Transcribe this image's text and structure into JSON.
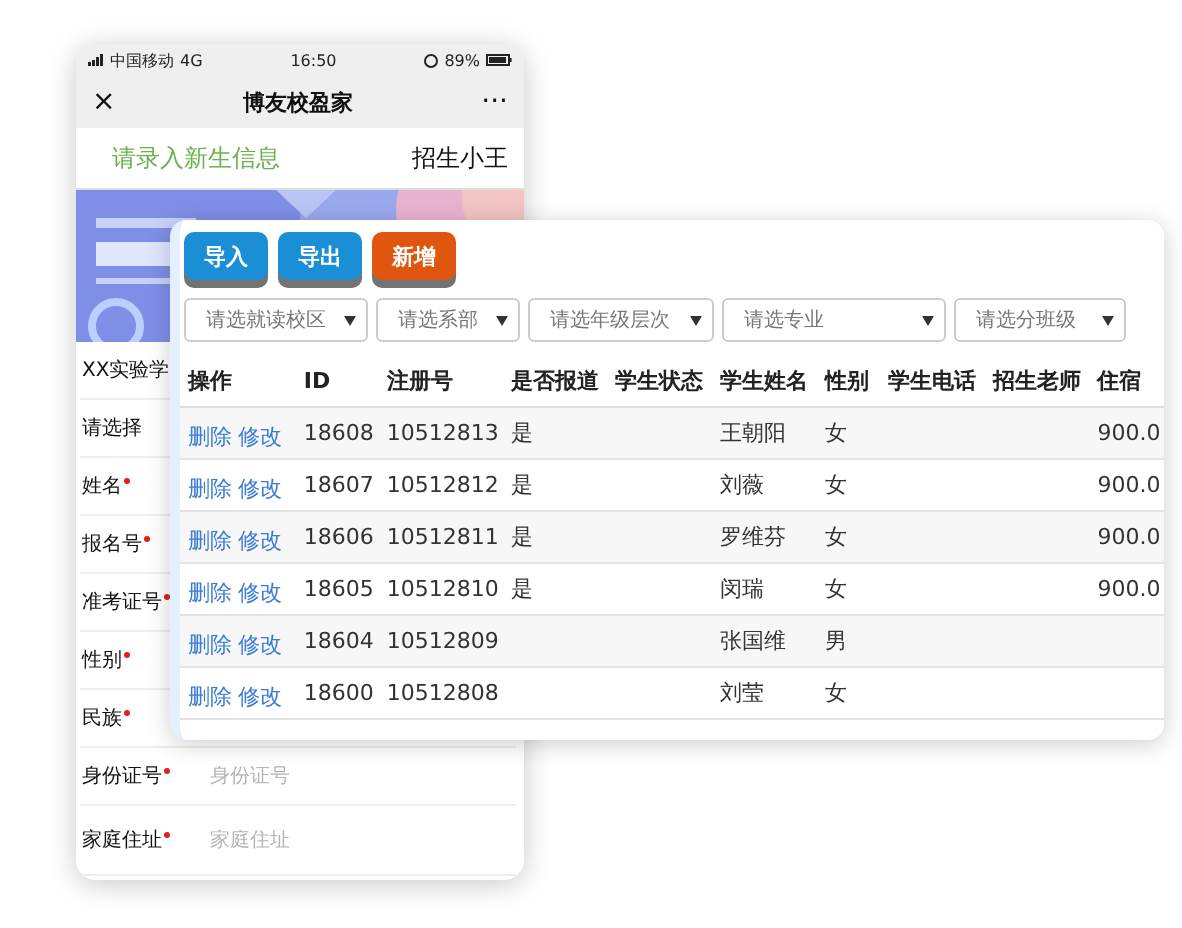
{
  "phone": {
    "status_bar": {
      "carrier": "中国移动",
      "network": "4G",
      "time": "16:50",
      "battery": "89%"
    },
    "nav": {
      "close": "×",
      "title": "博友校盈家",
      "more": "···"
    },
    "header": {
      "prompt": "请录入新生信息",
      "user": "招生小王"
    },
    "form": [
      {
        "label": "XX实验学",
        "required": false
      },
      {
        "label": "请选择",
        "required": false
      },
      {
        "label": "姓名",
        "required": true
      },
      {
        "label": "报名号",
        "required": true
      },
      {
        "label": "准考证号",
        "required": true
      },
      {
        "label": "性别",
        "required": true
      },
      {
        "label": "民族",
        "required": true
      },
      {
        "label": "身份证号",
        "required": true,
        "placeholder": "身份证号"
      },
      {
        "label": "家庭住址",
        "required": true,
        "placeholder": "家庭住址"
      }
    ]
  },
  "panel": {
    "buttons": [
      {
        "label": "导入",
        "color": "#1a8fd6"
      },
      {
        "label": "导出",
        "color": "#1a8fd6"
      },
      {
        "label": "新增",
        "color": "#e0560f"
      }
    ],
    "filters": [
      {
        "placeholder": "请选就读校区"
      },
      {
        "placeholder": "请选系部"
      },
      {
        "placeholder": "请选年级层次"
      },
      {
        "placeholder": "请选专业"
      },
      {
        "placeholder": "请选分班级"
      }
    ],
    "table": {
      "columns": [
        "操作",
        "ID",
        "注册号",
        "是否报道",
        "学生状态",
        "学生姓名",
        "性别",
        "学生电话",
        "招生老师",
        "住宿"
      ],
      "rows": [
        {
          "actions": [
            "删除",
            "修改"
          ],
          "id": "18608",
          "reg_no": "10512813",
          "reported": "是",
          "name": "王朝阳",
          "gender": "女",
          "fee": "900.0"
        },
        {
          "actions": [
            "删除",
            "修改"
          ],
          "id": "18607",
          "reg_no": "10512812",
          "reported": "是",
          "name": "刘薇",
          "gender": "女",
          "fee": "900.0"
        },
        {
          "actions": [
            "删除",
            "修改"
          ],
          "id": "18606",
          "reg_no": "10512811",
          "reported": "是",
          "name": "罗维芬",
          "gender": "女",
          "fee": "900.0"
        },
        {
          "actions": [
            "删除",
            "修改"
          ],
          "id": "18605",
          "reg_no": "10512810",
          "reported": "是",
          "name": "闵瑞",
          "gender": "女",
          "fee": "900.0"
        },
        {
          "actions": [
            "删除",
            "修改"
          ],
          "id": "18604",
          "reg_no": "10512809",
          "name": "张国维",
          "gender": "男"
        },
        {
          "actions": [
            "删除",
            "修改"
          ],
          "id": "18600",
          "reg_no": "10512808",
          "name": "刘莹",
          "gender": "女"
        }
      ]
    }
  }
}
